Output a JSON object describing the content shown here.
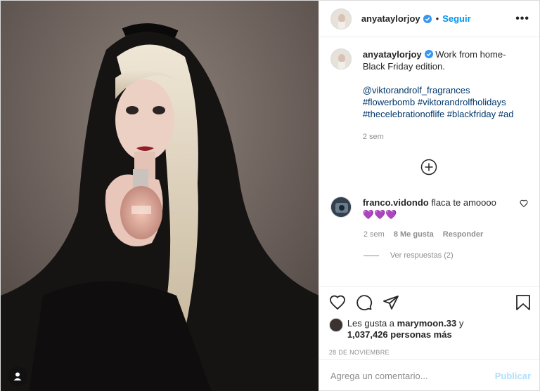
{
  "post": {
    "author": "anyataylorjoy",
    "follow_label": "Seguir",
    "dot": "•",
    "more_label": "•••"
  },
  "caption": {
    "author": "anyataylorjoy",
    "text_line1": "Work from home-",
    "text_line2": "Black Friday edition.",
    "mention": "@viktorandrolf_fragrances",
    "tag1": "#flowerbomb",
    "tag2": "#viktorandrolfholidays",
    "tag3": "#thecelebrationoflife",
    "tag4": "#blackfriday",
    "tag5": "#ad",
    "time": "2 sem"
  },
  "comment": {
    "author": "franco.vidondo",
    "text": "flaca te amoooo",
    "emoji": "💜💜💜",
    "time": "2 sem",
    "likes": "8 Me gusta",
    "reply_label": "Responder",
    "view_replies": "Ver respuestas (2)"
  },
  "likes": {
    "prefix": "Les gusta a",
    "user": "marymoon.33",
    "conj": "y",
    "count_text": "1,037,426 personas más"
  },
  "date": "28 DE NOVIEMBRE",
  "add_comment": {
    "placeholder": "Agrega un comentario...",
    "publish_label": "Publicar"
  },
  "colors": {
    "accent": "#0095f6",
    "hashtag": "#00376b",
    "muted": "#8e8e8e",
    "publish_disabled": "#b2dffc",
    "heart_emoji": "#8e5bd6"
  },
  "icons": [
    "verified-badge-icon",
    "more-options-icon",
    "add-circle-icon",
    "heart-icon",
    "comment-icon",
    "share-icon",
    "bookmark-icon",
    "user-tag-icon"
  ]
}
